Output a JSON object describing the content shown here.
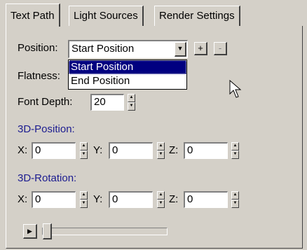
{
  "tabs": [
    "Text Path",
    "Light Sources",
    "Render Settings"
  ],
  "position": {
    "label": "Position:",
    "value": "Start Position",
    "options": [
      "Start Position",
      "End Position"
    ],
    "add_label": "+",
    "remove_label": "-"
  },
  "flatness": {
    "label": "Flatness:"
  },
  "font_depth": {
    "label": "Font Depth:",
    "value": "20"
  },
  "position3d": {
    "heading": "3D-Position:",
    "x_label": "X:",
    "x": "0",
    "y_label": "Y:",
    "y": "0",
    "z_label": "Z:",
    "z": "0"
  },
  "rotation3d": {
    "heading": "3D-Rotation:",
    "x_label": "X:",
    "x": "0",
    "y_label": "Y:",
    "y": "0",
    "z_label": "Z:",
    "z": "0"
  },
  "playback": {
    "slider_fraction": 0.0
  },
  "colors": {
    "section_heading": "#1c1c90",
    "selection": "#000080",
    "face": "#d4d0c8"
  }
}
